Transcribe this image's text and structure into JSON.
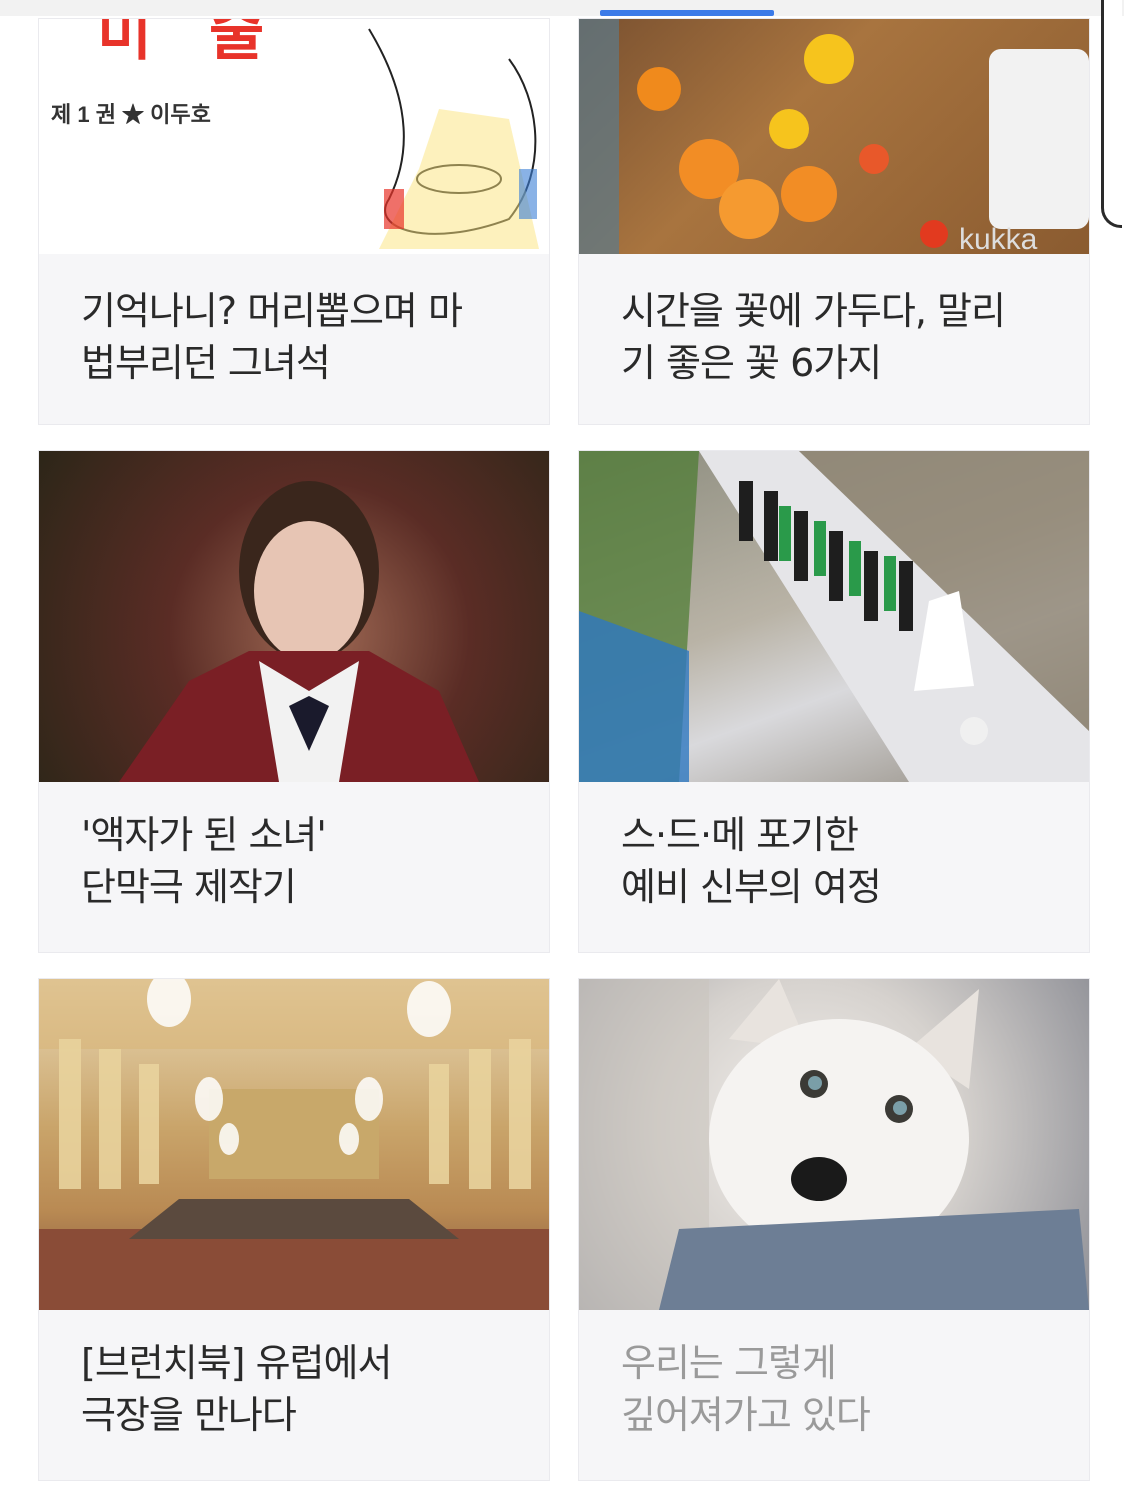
{
  "feed": {
    "cards": [
      {
        "title": "기억나니? 머리뽑으며 마\n법부리던 그녀석",
        "image": {
          "overlay_text": "제 1 권 ★ 이두호"
        },
        "dim": false
      },
      {
        "title": "시간을 꽃에 가두다, 말리\n기 좋은 꽃 6가지",
        "image": {
          "overlay_text": "kukka"
        },
        "dim": false
      },
      {
        "title": "'액자가 된 소녀'\n단막극 제작기",
        "image": {
          "overlay_text": ""
        },
        "dim": false
      },
      {
        "title": "스·드·메 포기한\n예비 신부의 여정",
        "image": {
          "overlay_text": ""
        },
        "dim": false
      },
      {
        "title": "[브런치북] 유럽에서\n극장을 만나다",
        "image": {
          "overlay_text": ""
        },
        "dim": false
      },
      {
        "title": "우리는 그렇게\n깊어져가고 있다",
        "image": {
          "overlay_text": ""
        },
        "dim": true
      }
    ]
  },
  "colors": {
    "indicator": "#3c7be8",
    "card_bg": "#f6f6f8",
    "text": "#2a2a2a",
    "text_dim": "#9a9a9a"
  }
}
